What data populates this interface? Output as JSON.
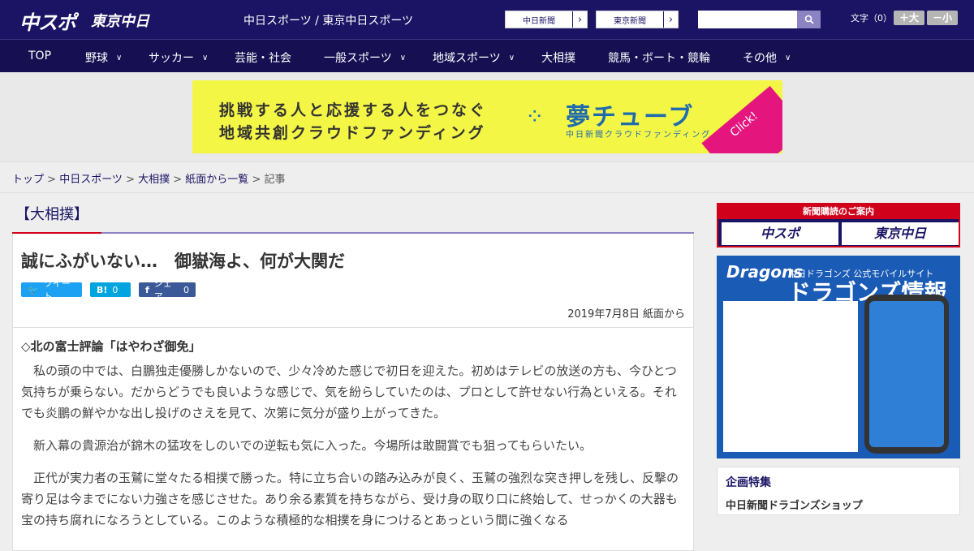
{
  "header": {
    "logo_main": "中スポ",
    "logo_sub": "東京中日",
    "site_title": "中日スポーツ / 東京中日スポーツ",
    "links": [
      "中日新聞",
      "東京新聞"
    ],
    "search_placeholder": "",
    "font_size_label": "文字（0）",
    "font_larger": "＋大",
    "font_smaller": "－小"
  },
  "nav": {
    "items": [
      "TOP",
      "野球",
      "サッカー",
      "芸能・社会",
      "一般スポーツ",
      "地域スポーツ",
      "大相撲",
      "競馬・ボート・競輪",
      "その他"
    ]
  },
  "banner": {
    "line1": "挑戦する人と応援する人をつなぐ",
    "line2": "地域共創クラウドファンディング",
    "name": "夢チューブ",
    "sub": "中日新聞クラウドファンディング",
    "click": "Click!"
  },
  "breadcrumb": {
    "items": [
      "トップ",
      "中日スポーツ",
      "大相撲",
      "紙面から一覧"
    ],
    "current": "記事",
    "sep": " > "
  },
  "article": {
    "category": "【大相撲】",
    "title": "誠にふがいない…　御嶽海よ、何が大関だ",
    "social": {
      "tweet": "ツイート",
      "hatena": "B!",
      "hatena_count": "0",
      "share": "シェア",
      "share_count": "0"
    },
    "date": "2019年7月8日 紙面から",
    "subtitle": "◇北の富士評論「はやわざ御免」",
    "paragraphs": [
      "私の頭の中では、白鵬独走優勝しかないので、少々冷めた感じで初日を迎えた。初めはテレビの放送の方も、今ひとつ気持ちが乗らない。だからどうでも良いような感じで、気を紛らしていたのは、プロとして許せない行為といえる。それでも炎鵬の鮮やかな出し投げのさえを見て、次第に気分が盛り上がってきた。",
      "新入幕の貴源治が錦木の猛攻をしのいでの逆転も気に入った。今場所は敢闘賞でも狙ってもらいたい。",
      "正代が実力者の玉鷲に堂々たる相撲で勝った。特に立ち合いの踏み込みが良く、玉鷲の強烈な突き押しを残し、反撃の寄り足は今までにない力強さを感じさせた。あり余る素質を持ちながら、受け身の取り口に終始して、せっかくの大器も宝の持ち腐れになろうとしている。このような積極的な相撲を身につけるとあっという間に強くなる"
    ]
  },
  "sidebar": {
    "subscribe_header": "新聞購読のご案内",
    "subscribe_links": [
      "中スポ",
      "東京中日"
    ],
    "dragons_logo": "Dragons",
    "dragons_sub": "中日ドラゴンズ 公式モバイルサイト",
    "dragons_title": "ドラゴンズ情報",
    "special_title": "企画特集",
    "special_item": "中日新聞ドラゴンズショップ"
  },
  "colors": {
    "brand": "#1b1464",
    "accent": "#d0021b",
    "twitter": "#1da1f2",
    "hatena": "#00a4de",
    "facebook": "#3b5998"
  }
}
